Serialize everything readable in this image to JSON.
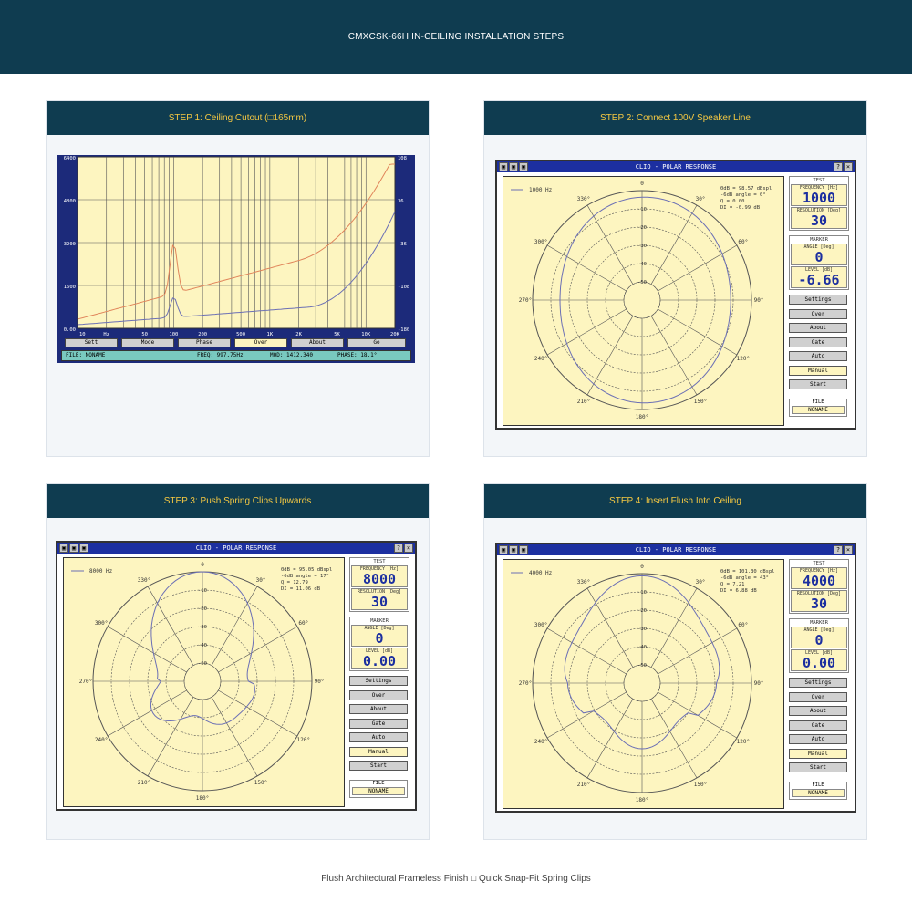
{
  "page": {
    "title": "CMXCSK-66H IN-CEILING INSTALLATION STEPS",
    "footer": "Flush Architectural Frameless Finish □ Quick Snap-Fit Spring Clips"
  },
  "colors": {
    "header_bg": "#0f3c50",
    "step_title": "#f5c842",
    "plot_bg": "#fdf5c0",
    "clio_title_bg": "#1c2fa0"
  },
  "steps": [
    {
      "title": "STEP 1: Ceiling Cutout (□165mm)",
      "bode": {
        "y_left_ticks": [
          "6400",
          "4800",
          "3200",
          "1600",
          "0.00"
        ],
        "y_right_ticks": [
          "108",
          "36",
          "-36",
          "-108",
          "-180"
        ],
        "x_ticks": [
          "10",
          "Hz",
          "50",
          "100",
          "200",
          "500",
          "1K",
          "2K",
          "5K",
          "10K",
          "20K"
        ],
        "buttons": [
          "Sett",
          "Mode",
          "Phase",
          "Over",
          "About",
          "Go"
        ],
        "status": {
          "file": "FILE: NONAME",
          "freq": "FREQ: 997.75Hz",
          "mod": "MOD: 1412.340",
          "phase": "PHASE: 18.1°"
        }
      }
    },
    {
      "title": "STEP 2: Connect 100V Speaker Line",
      "clio": {
        "window_title": "CLIO - POLAR RESPONSE",
        "legend": "1000 Hz",
        "info": [
          "0dB = 98.57 dBspl",
          "-6dB angle = 0°",
          "Q = 0.00",
          "DI = -0.99 dB"
        ],
        "frequency": "1000",
        "resolution": "30",
        "angle": "0",
        "level": "-6.66"
      }
    },
    {
      "title": "STEP 3: Push Spring Clips Upwards",
      "clio": {
        "window_title": "CLIO - POLAR RESPONSE",
        "legend": "8000 Hz",
        "info": [
          "0dB = 95.05 dBspl",
          "-6dB angle = 17°",
          "Q = 12.79",
          "DI = 11.06 dB"
        ],
        "frequency": "8000",
        "resolution": "30",
        "angle": "0",
        "level": "0.00"
      }
    },
    {
      "title": "STEP 4: Insert Flush Into Ceiling",
      "clio": {
        "window_title": "CLIO - POLAR RESPONSE",
        "legend": "4000 Hz",
        "info": [
          "0dB = 101.30 dBspl",
          "-6dB angle = 43°",
          "Q = 7.21",
          "DI = 6.88 dB"
        ],
        "frequency": "4000",
        "resolution": "30",
        "angle": "0",
        "level": "0.00"
      }
    }
  ],
  "clio_common": {
    "test_label": "TEST",
    "frequency_label": "FREQUENCY [Hz]",
    "resolution_label": "RESOLUTION [Deg]",
    "marker_label": "MARKER",
    "angle_label": "ANGLE [Deg]",
    "level_label": "LEVEL [dB]",
    "buttons": [
      "Settings",
      "Over",
      "About",
      "Gate",
      "Auto",
      "Manual",
      "Start"
    ],
    "active_button": "Manual",
    "file_label": "FILE",
    "file_value": "NONAME",
    "angle_labels": [
      "0",
      "30°",
      "60°",
      "90°",
      "120°",
      "150°",
      "180°",
      "210°",
      "240°",
      "270°",
      "300°",
      "330°"
    ],
    "ring_labels": [
      "-10",
      "-20",
      "-30",
      "-40",
      "-50"
    ]
  }
}
